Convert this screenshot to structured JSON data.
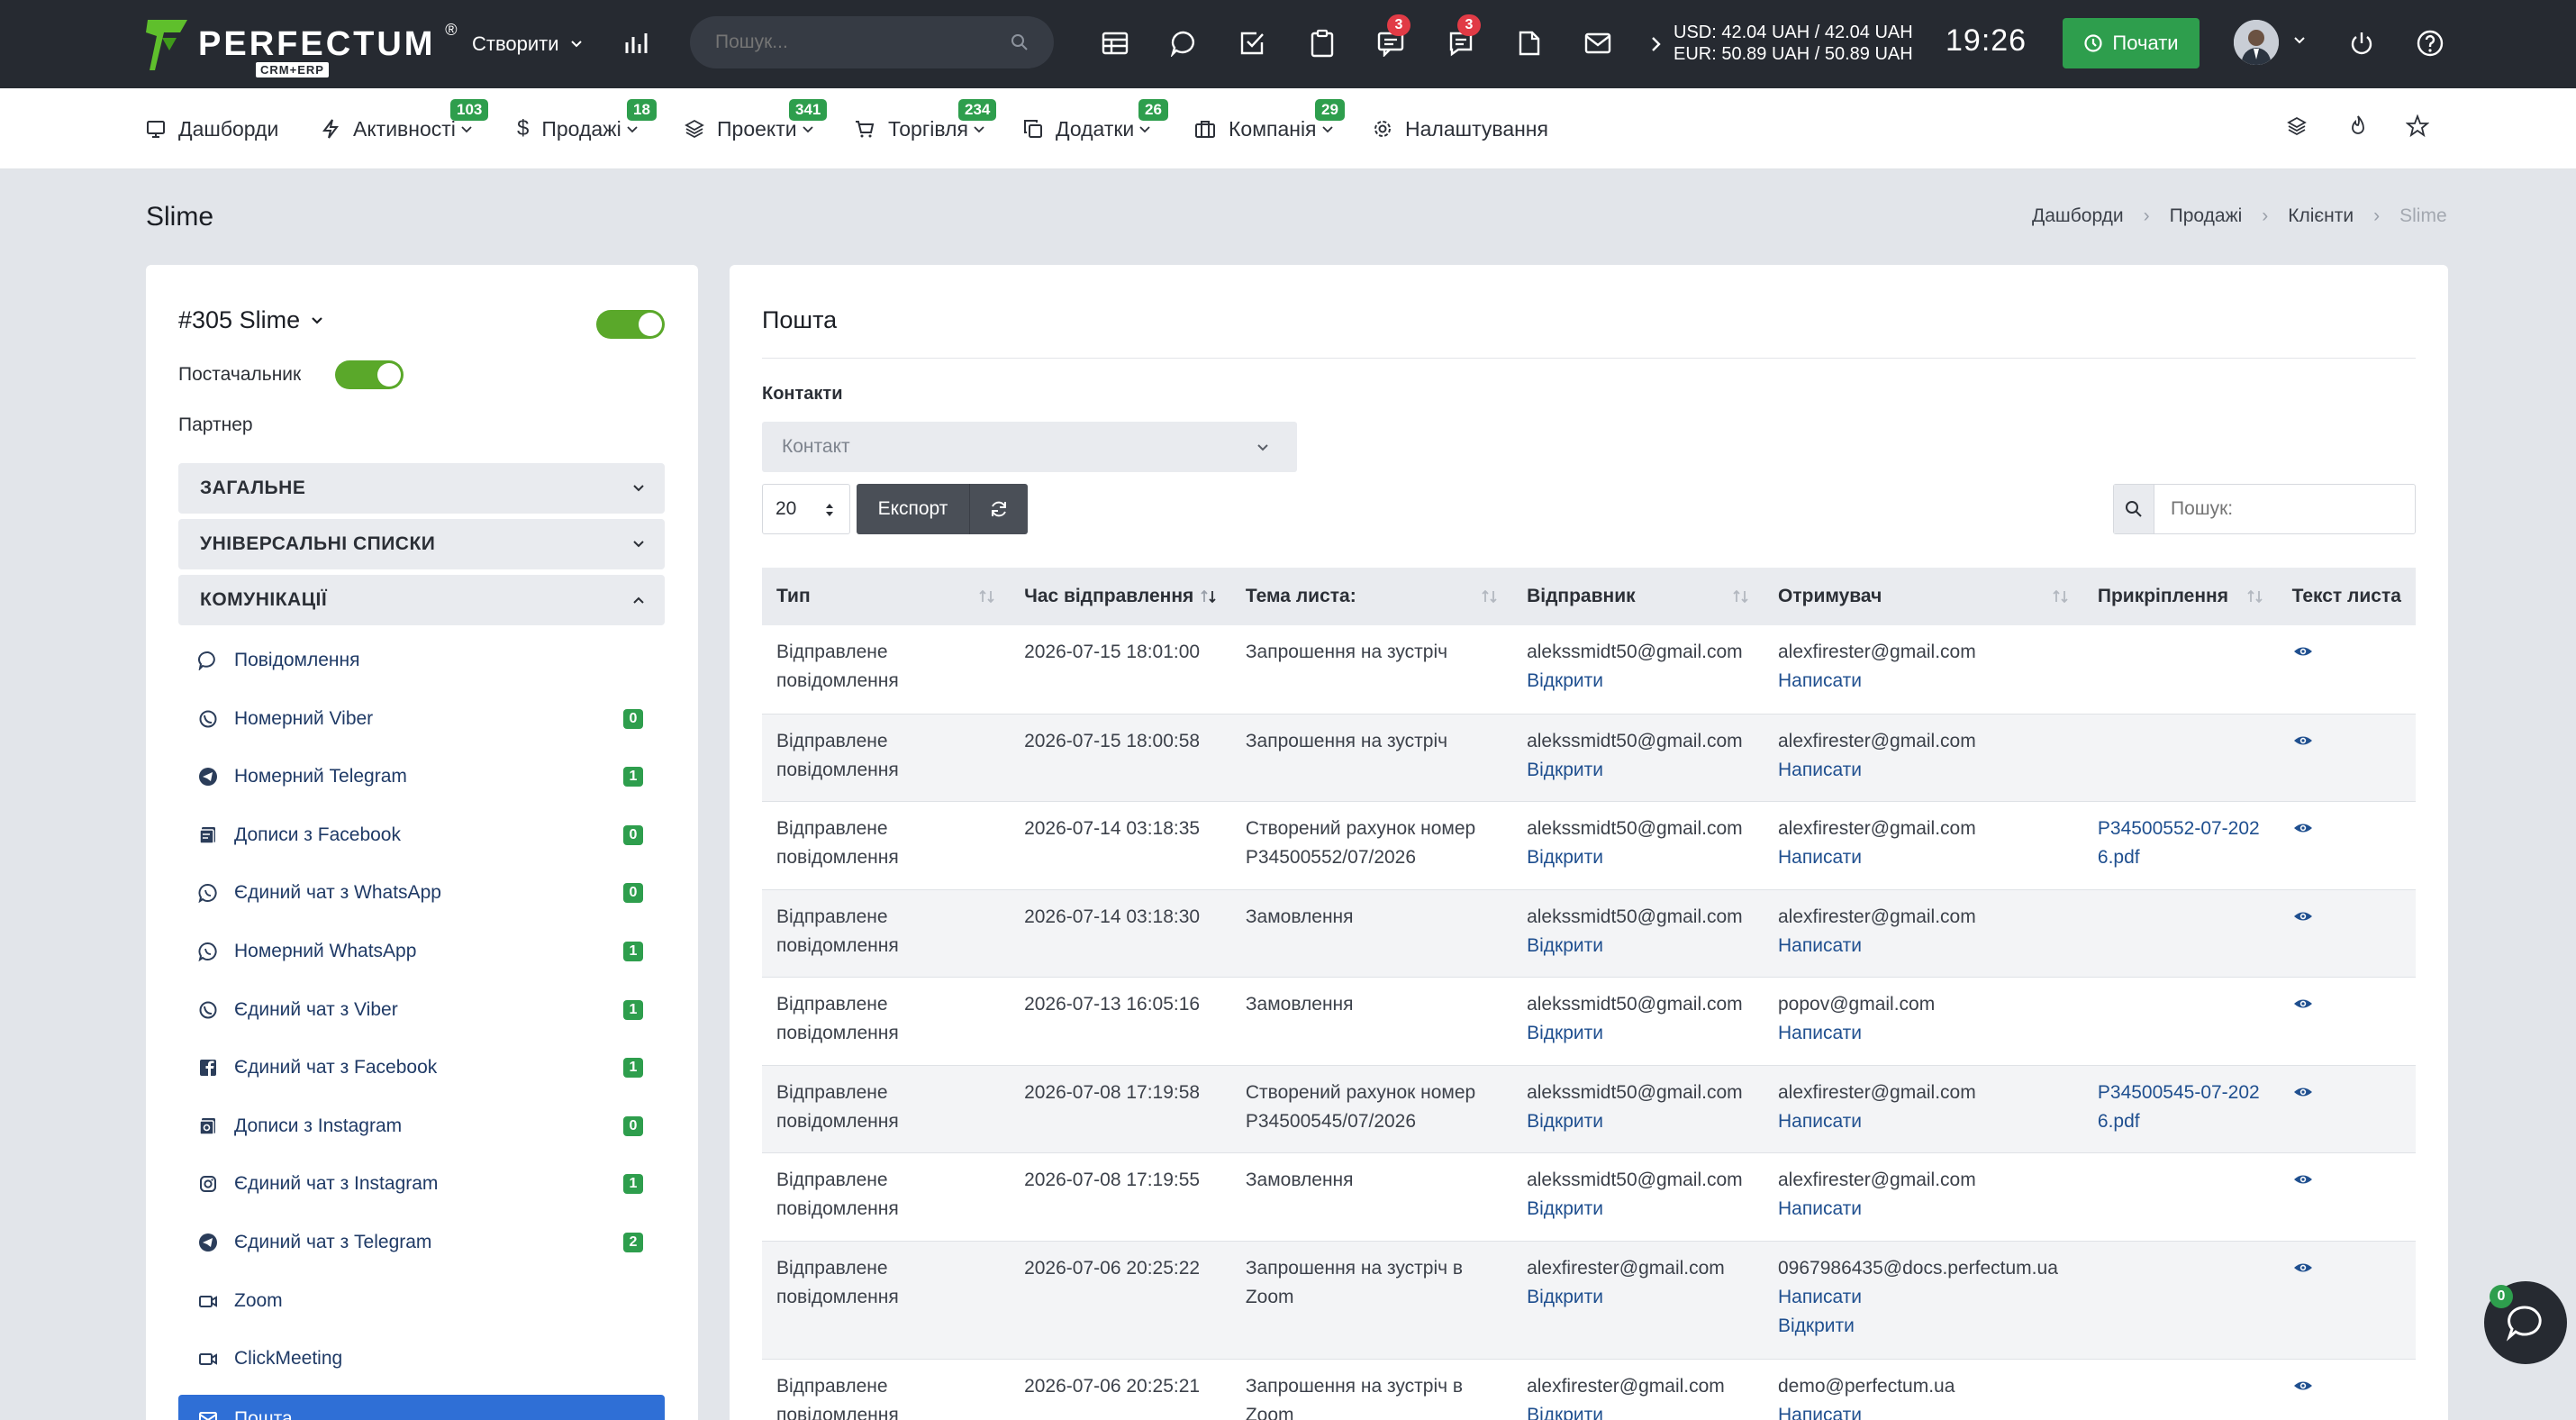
{
  "topbar": {
    "brand": "PERFECTUM",
    "brand_sub": "CRM+ERP",
    "brand_reg": "®",
    "create_label": "Створити",
    "search_placeholder": "Пошук...",
    "notif_badge_1": "3",
    "notif_badge_2": "3",
    "rate_usd": "USD: 42.04 UAH / 42.04 UAH",
    "rate_eur": "EUR: 50.89 UAH / 50.89 UAH",
    "clock": "19:26",
    "start_button": "Почати"
  },
  "nav": {
    "items": [
      {
        "label": "Дашборди",
        "badge": ""
      },
      {
        "label": "Активності",
        "badge": "103"
      },
      {
        "label": "Продажі",
        "badge": "18"
      },
      {
        "label": "Проекти",
        "badge": "341"
      },
      {
        "label": "Торгівля",
        "badge": "234"
      },
      {
        "label": "Додатки",
        "badge": "26"
      },
      {
        "label": "Компанія",
        "badge": "29"
      },
      {
        "label": "Налаштування",
        "badge": ""
      }
    ]
  },
  "page": {
    "title": "Slime",
    "breadcrumb": [
      "Дашборди",
      "Продажі",
      "Клієнти",
      "Slime"
    ]
  },
  "client": {
    "name": "#305 Slime",
    "supplier_label": "Постачальник",
    "partner_label": "Партнер",
    "sections": [
      "ЗАГАЛЬНЕ",
      "УНІВЕРСАЛЬНІ СПИСКИ",
      "КОМУНІКАЦІЇ"
    ],
    "menu": [
      {
        "label": "Повідомлення",
        "icon": "chat-bubble-icon",
        "badge": ""
      },
      {
        "label": "Номерний Viber",
        "icon": "viber-icon",
        "badge": "0"
      },
      {
        "label": "Номерний Telegram",
        "icon": "telegram-icon",
        "badge": "1"
      },
      {
        "label": "Дописи з Facebook",
        "icon": "facebook-posts-icon",
        "badge": "0"
      },
      {
        "label": "Єдиний чат з WhatsApp",
        "icon": "whatsapp-icon",
        "badge": "0"
      },
      {
        "label": "Номерний WhatsApp",
        "icon": "whatsapp-icon",
        "badge": "1"
      },
      {
        "label": "Єдиний чат з Viber",
        "icon": "viber-icon",
        "badge": "1"
      },
      {
        "label": "Єдиний чат з Facebook",
        "icon": "facebook-icon",
        "badge": "1"
      },
      {
        "label": "Дописи з Instagram",
        "icon": "instagram-posts-icon",
        "badge": "0"
      },
      {
        "label": "Єдиний чат з Instagram",
        "icon": "instagram-icon",
        "badge": "1"
      },
      {
        "label": "Єдиний чат з Telegram",
        "icon": "telegram-icon",
        "badge": "2"
      },
      {
        "label": "Zoom",
        "icon": "video-icon",
        "badge": ""
      },
      {
        "label": "ClickMeeting",
        "icon": "video-icon",
        "badge": ""
      },
      {
        "label": "Пошта",
        "icon": "mail-icon",
        "badge": ""
      }
    ]
  },
  "mail": {
    "title": "Пошта",
    "contacts_label": "Контакти",
    "contact_placeholder": "Контакт",
    "page_size": "20",
    "export_label": "Експорт",
    "search_placeholder": "Пошук:",
    "columns": [
      "Тип",
      "Час відправлення",
      "Тема листа:",
      "Відправник",
      "Отримувач",
      "Прикріплення",
      "Текст листа"
    ],
    "rows": [
      {
        "type": "Відправлене повідомлення",
        "time": "2026-07-15 18:01:00",
        "subject": "Запрошення на зустріч",
        "sender": "alekssmidt50@gmail.com",
        "sender_link": "Відкрити",
        "recipient": "alexfirester@gmail.com",
        "recipient_links": [
          "Написати"
        ],
        "attachment": ""
      },
      {
        "type": "Відправлене повідомлення",
        "time": "2026-07-15 18:00:58",
        "subject": "Запрошення на зустріч",
        "sender": "alekssmidt50@gmail.com",
        "sender_link": "Відкрити",
        "recipient": "alexfirester@gmail.com",
        "recipient_links": [
          "Написати"
        ],
        "attachment": ""
      },
      {
        "type": "Відправлене повідомлення",
        "time": "2026-07-14 03:18:35",
        "subject": "Створений рахунок номер P34500552/07/2026",
        "sender": "alekssmidt50@gmail.com",
        "sender_link": "Відкрити",
        "recipient": "alexfirester@gmail.com",
        "recipient_links": [
          "Написати"
        ],
        "attachment": "P34500552-07-2026.pdf"
      },
      {
        "type": "Відправлене повідомлення",
        "time": "2026-07-14 03:18:30",
        "subject": "Замовлення",
        "sender": "alekssmidt50@gmail.com",
        "sender_link": "Відкрити",
        "recipient": "alexfirester@gmail.com",
        "recipient_links": [
          "Написати"
        ],
        "attachment": ""
      },
      {
        "type": "Відправлене повідомлення",
        "time": "2026-07-13 16:05:16",
        "subject": "Замовлення",
        "sender": "alekssmidt50@gmail.com",
        "sender_link": "Відкрити",
        "recipient": "popov@gmail.com",
        "recipient_links": [
          "Написати"
        ],
        "attachment": ""
      },
      {
        "type": "Відправлене повідомлення",
        "time": "2026-07-08 17:19:58",
        "subject": "Створений рахунок номер P34500545/07/2026",
        "sender": "alekssmidt50@gmail.com",
        "sender_link": "Відкрити",
        "recipient": "alexfirester@gmail.com",
        "recipient_links": [
          "Написати"
        ],
        "attachment": "P34500545-07-2026.pdf"
      },
      {
        "type": "Відправлене повідомлення",
        "time": "2026-07-08 17:19:55",
        "subject": "Замовлення",
        "sender": "alekssmidt50@gmail.com",
        "sender_link": "Відкрити",
        "recipient": "alexfirester@gmail.com",
        "recipient_links": [
          "Написати"
        ],
        "attachment": ""
      },
      {
        "type": "Відправлене повідомлення",
        "time": "2026-07-06 20:25:22",
        "subject": "Запрошення на зустріч в Zoom",
        "sender": "alexfirester@gmail.com",
        "sender_link": "Відкрити",
        "recipient": "0967986435@docs.perfectum.ua",
        "recipient_links": [
          "Написати",
          "Відкрити"
        ],
        "attachment": ""
      },
      {
        "type": "Відправлене повідомлення",
        "time": "2026-07-06 20:25:21",
        "subject": "Запрошення на зустріч в Zoom",
        "sender": "alexfirester@gmail.com",
        "sender_link": "Відкрити",
        "recipient": "demo@perfectum.ua",
        "recipient_links": [
          "Написати"
        ],
        "attachment": ""
      }
    ]
  },
  "chat_widget": {
    "badge": "0"
  },
  "colors": {
    "topbar": "#262a31",
    "accent_green": "#2e9e4d",
    "active_blue": "#2f6fd6",
    "link": "#1f4f8f"
  }
}
